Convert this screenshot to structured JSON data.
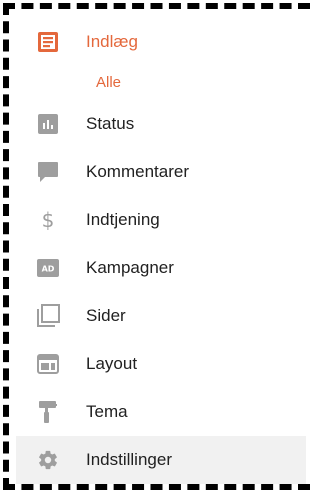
{
  "colors": {
    "accent": "#e4683c",
    "icon_gray": "#9e9e9e",
    "text": "#212121",
    "hover_bg": "#f1f1f1"
  },
  "nav": {
    "items": [
      {
        "label": "Indlæg",
        "icon": "posts-icon",
        "active": true
      },
      {
        "label": "Alle",
        "sub": true
      },
      {
        "label": "Status",
        "icon": "stats-icon"
      },
      {
        "label": "Kommentarer",
        "icon": "comment-icon"
      },
      {
        "label": "Indtjening",
        "icon": "dollar-icon"
      },
      {
        "label": "Kampagner",
        "icon": "ad-icon"
      },
      {
        "label": "Sider",
        "icon": "pages-icon"
      },
      {
        "label": "Layout",
        "icon": "layout-icon"
      },
      {
        "label": "Tema",
        "icon": "theme-roller-icon"
      },
      {
        "label": "Indstillinger",
        "icon": "gear-icon",
        "hover": true
      }
    ]
  }
}
